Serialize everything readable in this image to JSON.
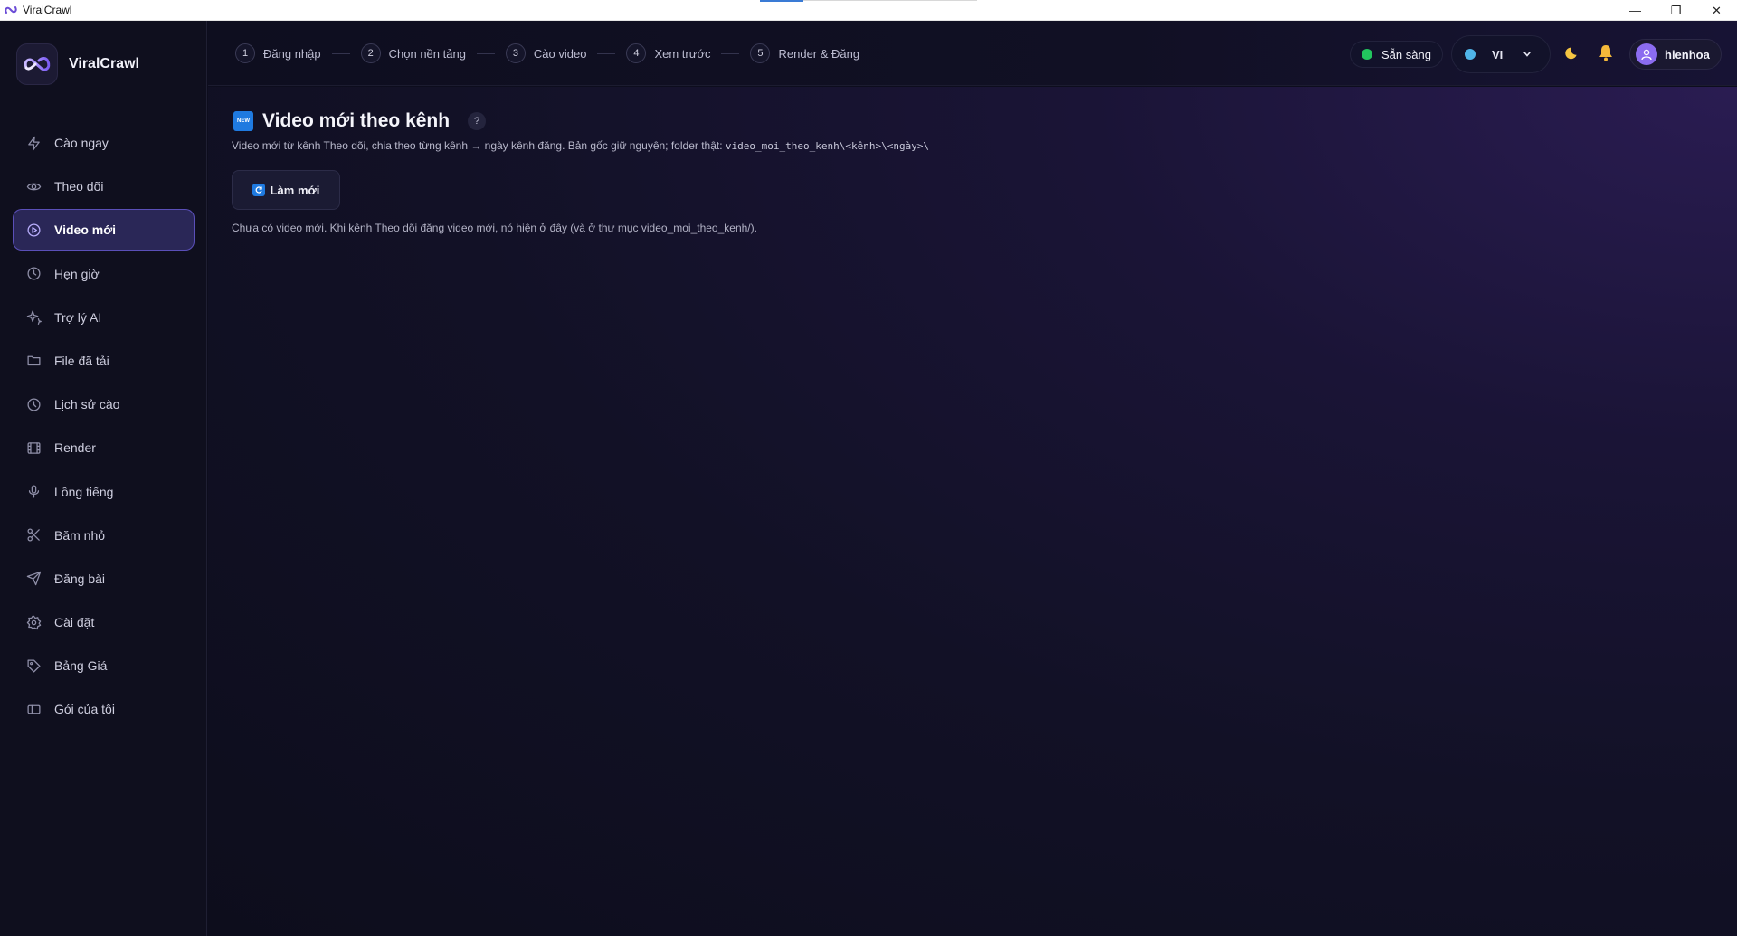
{
  "window": {
    "title": "ViralCrawl",
    "controls": {
      "minimize": "—",
      "restore": "❐",
      "close": "✕"
    }
  },
  "sidebar": {
    "brand": "ViralCrawl",
    "items": [
      {
        "label": "Cào ngay",
        "icon": "bolt-icon"
      },
      {
        "label": "Theo dõi",
        "icon": "eye-icon"
      },
      {
        "label": "Video mới",
        "icon": "play-circle-icon",
        "active": true
      },
      {
        "label": "Hẹn giờ",
        "icon": "clock-icon"
      },
      {
        "label": "Trợ lý AI",
        "icon": "sparkles-icon"
      },
      {
        "label": "File đã tải",
        "icon": "folder-icon"
      },
      {
        "label": "Lịch sử cào",
        "icon": "history-icon"
      },
      {
        "label": "Render",
        "icon": "film-icon"
      },
      {
        "label": "Lồng tiếng",
        "icon": "mic-icon"
      },
      {
        "label": "Băm nhỏ",
        "icon": "scissors-icon"
      },
      {
        "label": "Đăng bài",
        "icon": "send-icon"
      },
      {
        "label": "Cài đặt",
        "icon": "gear-icon"
      },
      {
        "label": "Bảng Giá",
        "icon": "tag-icon"
      },
      {
        "label": "Gói của tôi",
        "icon": "ticket-icon"
      }
    ]
  },
  "header": {
    "steps": [
      {
        "num": "1",
        "label": "Đăng nhập"
      },
      {
        "num": "2",
        "label": "Chọn nền tảng"
      },
      {
        "num": "3",
        "label": "Cào video"
      },
      {
        "num": "4",
        "label": "Xem trước"
      },
      {
        "num": "5",
        "label": "Render & Đăng"
      }
    ],
    "status": "Sẵn sàng",
    "language": "VI",
    "user": "hienhoa"
  },
  "main": {
    "badge": "NEW",
    "title": "Video mới theo kênh",
    "help": "?",
    "subtitle": "Video mới từ kênh Theo dõi, chia theo từng kênh → ngày kênh đăng. Bản gốc giữ nguyên; folder thật: ",
    "subtitle_path": "video_moi_theo_kenh\\<kênh>\\<ngày>\\",
    "refresh_label": "Làm mới",
    "empty_text": "Chưa có video mới. Khi kênh Theo dõi đăng video mới, nó hiện ở đây (và ở thư mục video_moi_theo_kenh/)."
  },
  "colors": {
    "accent": "#5a4fb8",
    "status_ok": "#22c55e",
    "badge_blue": "#1f7ae0"
  }
}
